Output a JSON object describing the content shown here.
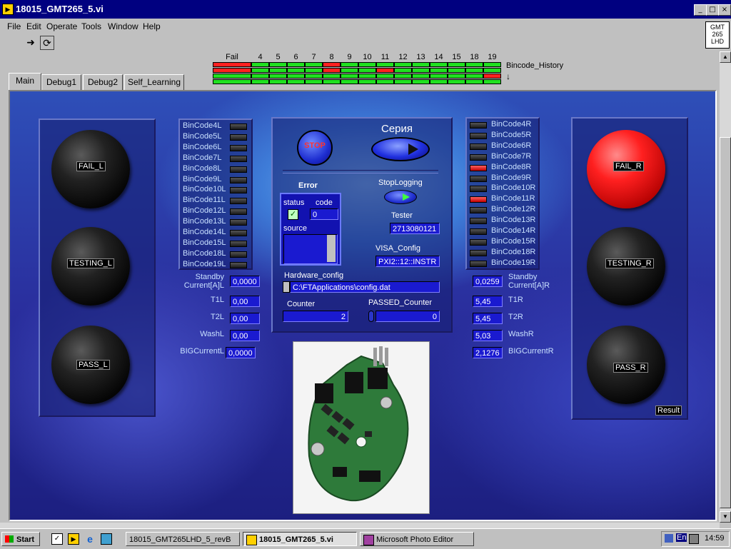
{
  "window": {
    "title": "18015_GMT265_5.vi"
  },
  "menu": [
    "File",
    "Edit",
    "Operate",
    "Tools",
    "Window",
    "Help"
  ],
  "logo_text": [
    "GMT",
    "265",
    "LHD"
  ],
  "bincode_history": {
    "columns": [
      "Fail",
      "4",
      "5",
      "6",
      "7",
      "8",
      "9",
      "10",
      "11",
      "12",
      "13",
      "14",
      "15",
      "18",
      "19"
    ],
    "label": "Bincode_History",
    "rows": [
      [
        "red",
        "green",
        "green",
        "green",
        "green",
        "red",
        "green",
        "green",
        "green",
        "green",
        "green",
        "green",
        "green",
        "green",
        "green"
      ],
      [
        "red",
        "green",
        "green",
        "green",
        "green",
        "red",
        "green",
        "green",
        "red",
        "green",
        "green",
        "green",
        "green",
        "green",
        "green"
      ],
      [
        "green",
        "green",
        "green",
        "green",
        "green",
        "green",
        "green",
        "green",
        "green",
        "green",
        "green",
        "green",
        "green",
        "green",
        "red"
      ],
      [
        "green",
        "green",
        "green",
        "green",
        "green",
        "green",
        "green",
        "green",
        "green",
        "green",
        "green",
        "green",
        "green",
        "green",
        "green"
      ]
    ]
  },
  "tabs": [
    "Main",
    "Debug1",
    "Debug2",
    "Self_Learning"
  ],
  "left_leds": {
    "fail": "FAIL_L",
    "testing": "TESTING_L",
    "pass": "PASS_L"
  },
  "right_leds": {
    "fail": "FAIL_R",
    "testing": "TESTING_R",
    "pass": "PASS_R",
    "result": "Result"
  },
  "bincodes_left": [
    {
      "label": "BinCode4L",
      "state": "off"
    },
    {
      "label": "BinCode5L",
      "state": "off"
    },
    {
      "label": "BinCode6L",
      "state": "off"
    },
    {
      "label": "BinCode7L",
      "state": "off"
    },
    {
      "label": "BinCode8L",
      "state": "off"
    },
    {
      "label": "BinCode9L",
      "state": "off"
    },
    {
      "label": "BinCode10L",
      "state": "off"
    },
    {
      "label": "BinCode11L",
      "state": "off"
    },
    {
      "label": "BinCode12L",
      "state": "off"
    },
    {
      "label": "BinCode13L",
      "state": "off"
    },
    {
      "label": "BinCode14L",
      "state": "off"
    },
    {
      "label": "BinCode15L",
      "state": "off"
    },
    {
      "label": "BinCode18L",
      "state": "off"
    },
    {
      "label": "BinCode19L",
      "state": "off"
    }
  ],
  "bincodes_right": [
    {
      "label": "BinCode4R",
      "state": "off"
    },
    {
      "label": "BinCode5R",
      "state": "off"
    },
    {
      "label": "BinCode6R",
      "state": "off"
    },
    {
      "label": "BinCode7R",
      "state": "off"
    },
    {
      "label": "BinCode8R",
      "state": "on"
    },
    {
      "label": "BinCode9R",
      "state": "off"
    },
    {
      "label": "BinCode10R",
      "state": "off"
    },
    {
      "label": "BinCode11R",
      "state": "on"
    },
    {
      "label": "BinCode12R",
      "state": "off"
    },
    {
      "label": "BinCode13R",
      "state": "off"
    },
    {
      "label": "BinCode14R",
      "state": "off"
    },
    {
      "label": "BinCode15R",
      "state": "off"
    },
    {
      "label": "BinCode18R",
      "state": "off"
    },
    {
      "label": "BinCode19R",
      "state": "off"
    }
  ],
  "left_meas": [
    {
      "label": "Standby Current[A]L",
      "value": "0,0000"
    },
    {
      "label": "T1L",
      "value": "0,00"
    },
    {
      "label": "T2L",
      "value": "0,00"
    },
    {
      "label": "WashL",
      "value": "0,00"
    },
    {
      "label": "BIGCurrentL",
      "value": "0,0000"
    }
  ],
  "right_meas": [
    {
      "label": "Standby Current[A]R",
      "value": "0,0259"
    },
    {
      "label": "T1R",
      "value": "5,45"
    },
    {
      "label": "T2R",
      "value": "5,45"
    },
    {
      "label": "WashR",
      "value": "5,03"
    },
    {
      "label": "BIGCurrentR",
      "value": "2,1276"
    }
  ],
  "center": {
    "stop_label": "STOP",
    "series_label": "Серия",
    "error_label": "Error",
    "status_label": "status",
    "code_label": "code",
    "code_value": "0",
    "source_label": "source",
    "stoplogging_label": "StopLogging",
    "tester_label": "Tester",
    "tester_value": "2713080121",
    "visa_label": "VISA_Config",
    "visa_value": "PXI2::12::INSTR",
    "hw_label": "Hardware_config",
    "hw_value": "C:\\FTApplications\\config.dat",
    "counter_label": "Counter",
    "counter_value": "2",
    "passed_label": "PASSED_Counter",
    "passed_value": "0"
  },
  "colors": {
    "bin_red": "#ff2020",
    "bin_green": "#20e020",
    "panel_blue": "#2a2f9e"
  },
  "taskbar": {
    "start": "Start",
    "buttons": [
      "18015_GMT265LHD_5_revB",
      "18015_GMT265_5.vi",
      "Microsoft Photo Editor"
    ],
    "active_index": 1,
    "lang": "En",
    "clock": "14:59"
  }
}
